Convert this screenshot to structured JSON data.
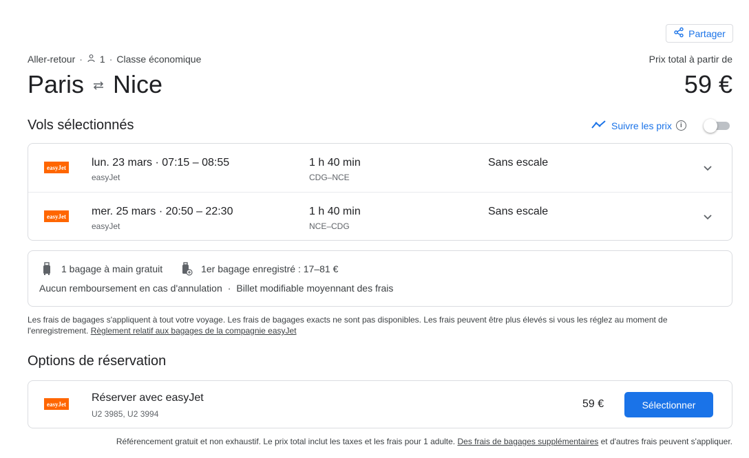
{
  "share": {
    "label": "Partager",
    "icon": "share-icon"
  },
  "trip": {
    "type": "Aller-retour",
    "passengers": "1",
    "cabin": "Classe économique"
  },
  "route": {
    "origin": "Paris",
    "destination": "Nice"
  },
  "price": {
    "label": "Prix total à partir de",
    "total": "59 €"
  },
  "flights_section": {
    "title": "Vols sélectionnés",
    "track_label": "Suivre les prix",
    "track_enabled": false
  },
  "flights": [
    {
      "date": "lun. 23 mars",
      "times": "07:15 – 08:55",
      "airline": "easyJet",
      "duration": "1 h 40 min",
      "route": "CDG–NCE",
      "stops": "Sans escale",
      "logo_text": "easyJet"
    },
    {
      "date": "mer. 25 mars",
      "times": "20:50 – 22:30",
      "airline": "easyJet",
      "duration": "1 h 40 min",
      "route": "NCE–CDG",
      "stops": "Sans escale",
      "logo_text": "easyJet"
    }
  ],
  "bags": {
    "carry_on": "1 bagage à main gratuit",
    "checked": "1er bagage enregistré : 17–81 €",
    "refund": "Aucun remboursement en cas d'annulation",
    "change": "Billet modifiable moyennant des frais"
  },
  "bag_note": {
    "text": "Les frais de bagages s'appliquent à tout votre voyage. Les frais de bagages exacts ne sont pas disponibles. Les frais peuvent être plus élevés si vous les réglez au moment de l'enregistrement.",
    "link": "Règlement relatif aux bagages de la compagnie easyJet"
  },
  "booking": {
    "title": "Options de réservation",
    "provider": "Réserver avec easyJet",
    "flight_numbers": "U2 3985, U2 3994",
    "price": "59 €",
    "select_label": "Sélectionner",
    "logo_text": "easyJet"
  },
  "footer": {
    "text_before": "Référencement gratuit et non exhaustif. Le prix total inclut les taxes et les frais pour 1 adulte.",
    "link": "Des frais de bagages supplémentaires",
    "text_after": "et d'autres frais peuvent s'appliquer."
  },
  "colors": {
    "accent": "#1a73e8",
    "easyjet": "#ff6600",
    "border": "#dadce0"
  }
}
